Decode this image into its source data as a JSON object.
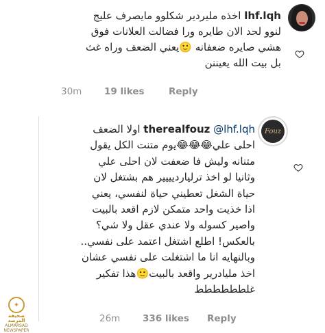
{
  "comment1": {
    "username": "lhf.lqh",
    "lines": [
      "اخذه مليردير  شكلوو مايصرف عليج",
      "لنوو لحد الان طايره ورا فضالت العلانات فوق",
      "هشي  صايره ضعفانه 🙂يعني  الضعف وراه غث",
      "بل بيت الله يعيننن"
    ],
    "line1_text": " اخذه مليردير  شكلوو مايصرف عليج",
    "time": "30m",
    "likes": "19 likes",
    "reply": "Reply"
  },
  "comment2": {
    "username": "therealfouz",
    "mention": "@lhf.lqh",
    "line1_text": " اولا الضعف",
    "lines": [
      "احلى علي😂😂😂يوم متنت الكل يقول",
      "متنانه وليش فا ضعفت لان احلى علي",
      "وثانيا لو اخذ ترليارديييير هم بشتغل لان",
      "حياة الشغل تعطيني حياة لنفسي، يعني",
      "اذا خذيت واحد متمكن لازم اقعد بالبيت",
      "واصير كسوله ولا عندي عقل ولا شي؟",
      "بالعكس! اطلع اشتغل اعتمد على نفسي..",
      "وبالنهايه انا ما اشتغلت على نفسي عشان",
      "اخذ مليادرير واقعد بالبيت🙂هذا تفكير",
      "غلطططططط"
    ],
    "time": "26m",
    "likes": "336 likes",
    "reply": "Reply",
    "avatar_text": "Fouz"
  },
  "icons": {
    "heart1": "heart-outline-icon",
    "heart2": "heart-outline-icon"
  },
  "watermark": {
    "name": "صحيفة المرصد",
    "sub": "ALMARSAD NEWSPAPER"
  },
  "colors": {
    "text": "#262626",
    "meta": "#8e8e8e",
    "mention": "#003569",
    "divider": "#dbdbdb"
  }
}
